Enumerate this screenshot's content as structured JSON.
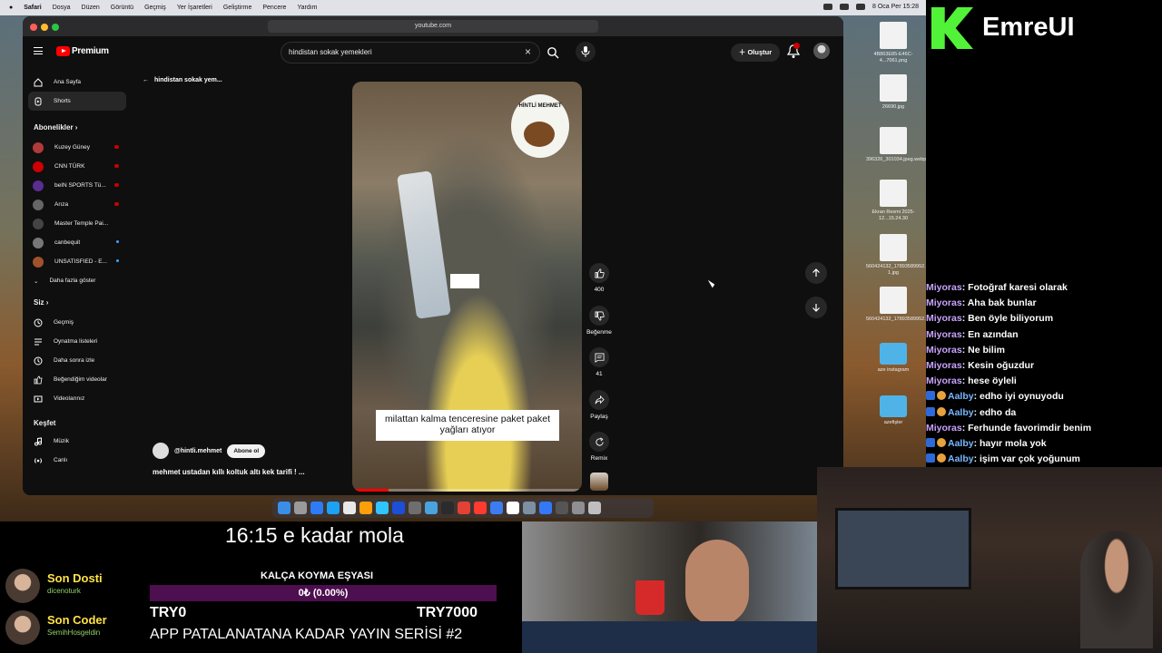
{
  "menubar": {
    "items": [
      "Safari",
      "Dosya",
      "Düzen",
      "Görüntü",
      "Geçmiş",
      "Yer İşaretleri",
      "Geliştirme",
      "Pencere",
      "Yardım"
    ],
    "clock": "8 Oca Per 15:28"
  },
  "browser": {
    "url": "youtube.com"
  },
  "youtube": {
    "brand": "Premium",
    "search": {
      "value": "hindistan sokak yemekleri"
    },
    "create_label": "Oluştur",
    "notification_count": "9+"
  },
  "sidebar": {
    "nav": [
      {
        "label": "Ana Sayfa",
        "icon": "home-icon"
      },
      {
        "label": "Shorts",
        "icon": "shorts-icon"
      }
    ],
    "subs_title": "Abonelikler",
    "subs": [
      {
        "label": "Kuzey Güney",
        "color": "#b03a3a",
        "dot": "live"
      },
      {
        "label": "CNN TÜRK",
        "color": "#cc0000",
        "dot": "live"
      },
      {
        "label": "beIN SPORTS Tü...",
        "color": "#5a2d91",
        "dot": "live"
      },
      {
        "label": "Arıza",
        "color": "#666666",
        "dot": "live"
      },
      {
        "label": "Master Temple Pai...",
        "color": "#444444",
        "dot": "none"
      },
      {
        "label": "canbequit",
        "color": "#777777",
        "dot": "new"
      },
      {
        "label": "UNSATISFIED - E...",
        "color": "#a0522d",
        "dot": "new"
      }
    ],
    "more_label": "Daha fazla göster",
    "you_title": "Siz",
    "you": [
      {
        "label": "Geçmiş",
        "icon": "history-icon"
      },
      {
        "label": "Oynatma listeleri",
        "icon": "playlist-icon"
      },
      {
        "label": "Daha sonra izle",
        "icon": "clock-icon"
      },
      {
        "label": "Beğendiğim videolar",
        "icon": "thumbs-up-icon"
      },
      {
        "label": "Videolarınız",
        "icon": "video-icon"
      }
    ],
    "explore_title": "Keşfet",
    "explore": [
      {
        "label": "Müzik",
        "icon": "music-icon"
      },
      {
        "label": "Canlı",
        "icon": "live-icon"
      }
    ]
  },
  "shorts": {
    "back_label": "hindistan sokak yem...",
    "sticker_text": "HİNTLİ MEHMET",
    "caption": "milattan kalma tenceresine paket paket yağları atıyor",
    "channel": "@hintli.mehmet",
    "subscribe_label": "Abone ol",
    "title": "mehmet ustadan kıllı koltuk altı kek tarifi ! ...",
    "progress": 0.16,
    "actions": {
      "like_count": "400",
      "dislike_label": "Beğenme",
      "comment_count": "41",
      "share_label": "Paylaş",
      "remix_label": "Remix"
    }
  },
  "desktop_files": [
    {
      "name": "4B863E85-E46C-4...7061.png",
      "kind": "image"
    },
    {
      "name": "26690.jpg",
      "kind": "image"
    },
    {
      "name": "396326_301034.jpeg.webp",
      "kind": "image"
    },
    {
      "name": "Ekran Resmi 2025-12...15.24.30",
      "kind": "image"
    },
    {
      "name": "560424132_17893589952...5_n-1.jpg",
      "kind": "image"
    },
    {
      "name": "560424132_17893589952...65_n.jpg",
      "kind": "image"
    },
    {
      "name": "aze instagram",
      "kind": "folder"
    },
    {
      "name": "azefişler",
      "kind": "folder"
    }
  ],
  "stream": {
    "logo_text": "EmreUI",
    "chat": [
      {
        "user": "Miyoras",
        "msg": "Fotoğraf karesi olarak",
        "alt": false
      },
      {
        "user": "Miyoras",
        "msg": "Aha bak bunlar",
        "alt": false
      },
      {
        "user": "Miyoras",
        "msg": "Ben öyle biliyorum",
        "alt": false
      },
      {
        "user": "Miyoras",
        "msg": "En azından",
        "alt": false
      },
      {
        "user": "Miyoras",
        "msg": "Ne bilim",
        "alt": false
      },
      {
        "user": "Miyoras",
        "msg": "Kesin oğuzdur",
        "alt": false
      },
      {
        "user": "Miyoras",
        "msg": "hese öyleli",
        "alt": false
      },
      {
        "user": "Aalby",
        "msg": "edho iyi oynuyodu",
        "alt": true
      },
      {
        "user": "Aalby",
        "msg": "edho da",
        "alt": true
      },
      {
        "user": "Miyoras",
        "msg": "Ferhunde favorimdir benim",
        "alt": false
      },
      {
        "user": "Aalby",
        "msg": "hayır mola yok",
        "alt": true
      },
      {
        "user": "Aalby",
        "msg": "işim var çok yoğunum",
        "alt": true
      }
    ],
    "break_text": "16:15 e kadar mola",
    "donors": [
      {
        "title": "Son Dosti",
        "sub": "dicenoturk"
      },
      {
        "title": "Son Coder",
        "sub": "SemihHosgeldin"
      }
    ],
    "goal": {
      "label": "KALÇA KOYMA EŞYASI",
      "progress_text": "0₺ (0.00%)",
      "fraction": 0.0,
      "min": "TRY0",
      "max": "TRY7000"
    },
    "series_text": "APP PATALANATANA KADAR YAYIN SERİSİ #2"
  },
  "colors": {
    "yt_red": "#ff0000",
    "logo_green": "#52f238",
    "donor_yellow": "#ffe24a",
    "goal_purple": "#4d0f4f"
  }
}
